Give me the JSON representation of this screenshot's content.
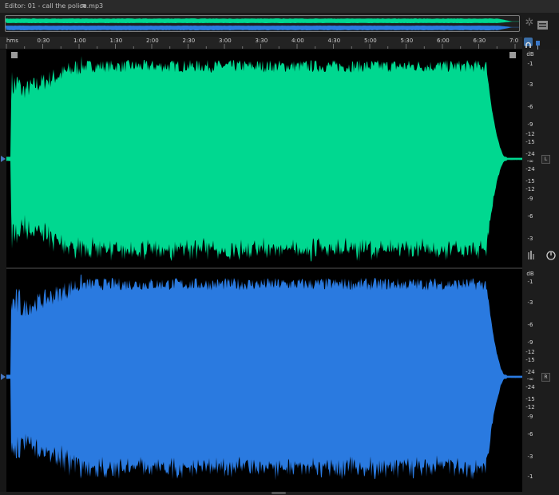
{
  "editor": {
    "title": "Editor: 01 - call the police.mp3",
    "menu_icon": "hamburger-icon"
  },
  "colors": {
    "left_channel": "#00d890",
    "right_channel": "#2a7ae0",
    "background": "#000000"
  },
  "timeline": {
    "unit_label": "hms",
    "ticks": [
      "0:30",
      "1:00",
      "1:30",
      "2:00",
      "2:30",
      "3:00",
      "3:30",
      "4:00",
      "4:30",
      "5:00",
      "5:30",
      "6:00",
      "6:30",
      "7:0"
    ]
  },
  "channels": [
    {
      "name": "left",
      "tag": "L",
      "db_unit": "dB",
      "db_labels_top": [
        "-1",
        "-3",
        "-6",
        "-9",
        "-12",
        "-15",
        "-24"
      ],
      "db_center": "-∞",
      "db_labels_bottom": [
        "-24",
        "-15",
        "-12",
        "-9",
        "-6",
        "-3"
      ]
    },
    {
      "name": "right",
      "tag": "R",
      "db_unit": "dB",
      "db_labels_top": [
        "-1",
        "-3",
        "-6",
        "-9",
        "-12",
        "-15",
        "-24"
      ],
      "db_center": "-∞",
      "db_labels_bottom": [
        "-24",
        "-15",
        "-12",
        "-9",
        "-6",
        "-3",
        "-1"
      ]
    }
  ],
  "icons": {
    "zoom_selection": "zoom-selection-icon",
    "panel_toggle": "panel-icon",
    "snap": "snap-icon",
    "pin": "pin-icon",
    "volume": "volume-knob-icon"
  }
}
